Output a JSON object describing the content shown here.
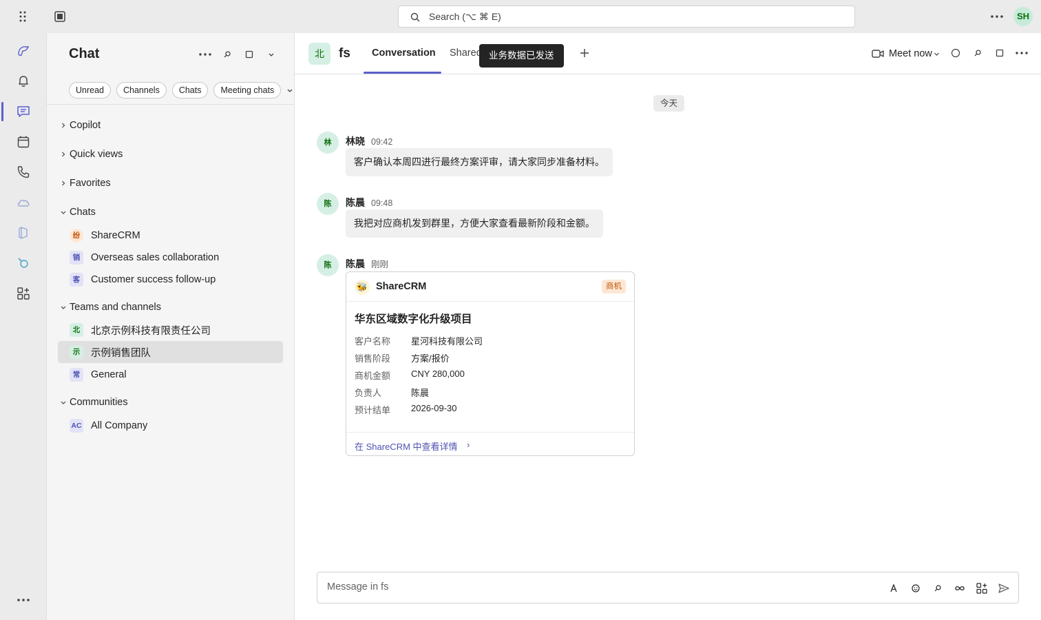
{
  "topbar": {
    "search_placeholder": "Search (⌥ ⌘ E)",
    "user_initials": "SH"
  },
  "rail": {
    "items": [
      {
        "icon": "copilot-icon"
      },
      {
        "icon": "activity-bell-icon"
      },
      {
        "icon": "chat-icon",
        "active": true
      },
      {
        "icon": "calendar-icon"
      },
      {
        "icon": "calls-phone-icon"
      },
      {
        "icon": "onedrive-cloud-icon"
      },
      {
        "icon": "m365-icon"
      },
      {
        "icon": "viva-icon"
      },
      {
        "icon": "apps-icon"
      }
    ]
  },
  "pane": {
    "title": "Chat",
    "filters": [
      "Unread",
      "Channels",
      "Chats",
      "Meeting chats"
    ],
    "sections": {
      "copilot": "Copilot",
      "quick_views": "Quick views",
      "favorites": "Favorites",
      "chats": "Chats",
      "teams": "Teams and channels",
      "communities": "Communities"
    },
    "chats": [
      {
        "avatar": "纷",
        "name": "ShareCRM"
      },
      {
        "avatar": "销",
        "name": "Overseas sales collaboration"
      },
      {
        "avatar": "客",
        "name": "Customer success follow-up"
      }
    ],
    "teams": [
      {
        "avatar": "北",
        "name": "北京示例科技有限责任公司"
      },
      {
        "avatar": "示",
        "name": "示例销售团队"
      },
      {
        "avatar": "常",
        "name": "General"
      }
    ],
    "communities": [
      {
        "avatar": "AC",
        "name": "All Company"
      }
    ]
  },
  "channel": {
    "avatar": "北",
    "name": "fs",
    "tabs": [
      "Conversation",
      "Shared"
    ],
    "tooltip": "业务数据已发送",
    "meet_label": "Meet now"
  },
  "conversation": {
    "date_separator": "今天",
    "messages": [
      {
        "avatar": "林",
        "author": "林晓",
        "time": "09:42",
        "text": "客户确认本周四进行最终方案评审，请大家同步准备材料。"
      },
      {
        "avatar": "陈",
        "author": "陈晨",
        "time": "09:48",
        "text": "我把对应商机发到群里，方便大家查看最新阶段和金额。"
      },
      {
        "avatar": "陈",
        "author": "陈晨",
        "time": "刚刚"
      }
    ],
    "card": {
      "app": "ShareCRM",
      "badge": "商机",
      "title": "华东区域数字化升级项目",
      "fields": [
        {
          "key": "客户名称",
          "value": "星河科技有限公司"
        },
        {
          "key": "销售阶段",
          "value": "方案/报价"
        },
        {
          "key": "商机金额",
          "value": "CNY 280,000"
        },
        {
          "key": "负责人",
          "value": "陈晨"
        },
        {
          "key": "预计结单",
          "value": "2026-09-30"
        }
      ],
      "link": "在 ShareCRM 中查看详情",
      "link_chevron": "›"
    }
  },
  "composer": {
    "placeholder": "Message in fs"
  },
  "colors": {
    "accent": "#5b5fc7",
    "tooltip_bg": "#242424",
    "badge_orange": "#c2570d"
  }
}
